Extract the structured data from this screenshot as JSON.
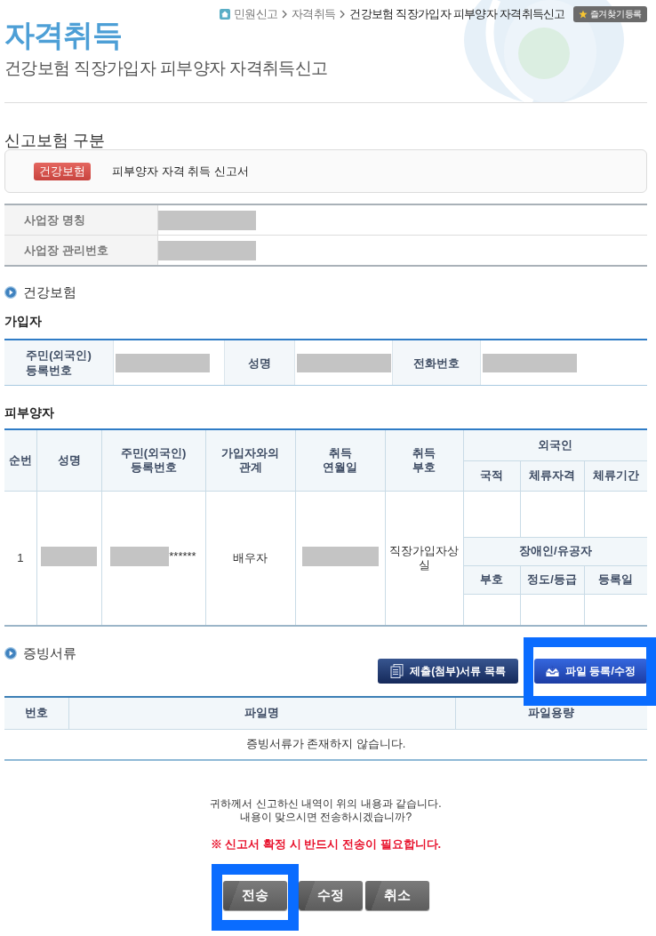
{
  "breadcrumb": [
    {
      "label": "민원신고",
      "current": false
    },
    {
      "label": "자격취득",
      "current": false
    },
    {
      "label": "건강보험 직장가입자 피부양자 자격취득신고",
      "current": true
    }
  ],
  "bookmark_button": {
    "label": "즐겨찾기등록"
  },
  "title": "자격취득",
  "subtitle": "건강보험 직장가입자 피부양자 자격취득신고",
  "insurance_type": {
    "heading": "신고보험 구분",
    "badge": "건강보험",
    "form_name": "피부양자 자격 취득 신고서"
  },
  "workplace": [
    {
      "label": "사업장 명칭",
      "redacted": true
    },
    {
      "label": "사업장 관리번호",
      "redacted": true
    }
  ],
  "health_section": {
    "title": "건강보험"
  },
  "subscriber": {
    "heading": "가입자",
    "fields": [
      {
        "label": "주민(외국인)\n등록번호",
        "redacted": true
      },
      {
        "label": "성명",
        "redacted": true
      },
      {
        "label": "전화번호",
        "redacted": true
      }
    ]
  },
  "dependents": {
    "heading": "피부양자",
    "columns": [
      "순번",
      "성명",
      "주민(외국인)\n등록번호",
      "가입자와의\n관계",
      "취득\n연월일",
      "취득\n부호"
    ],
    "foreigner": {
      "label": "외국인",
      "columns": [
        "국적",
        "체류자격",
        "체류기간"
      ]
    },
    "disability": {
      "label": "장애인/유공자",
      "columns": [
        "부호",
        "정도/등급",
        "등록일"
      ]
    },
    "rows": [
      {
        "cells": [
          {
            "text": "1",
            "redacted": false
          },
          {
            "redacted": true
          },
          {
            "text": "******",
            "redacted": true
          },
          {
            "text": "배우자",
            "redacted": false
          },
          {
            "redacted": true
          },
          {
            "text": "직장가입자상실",
            "redacted": false
          }
        ]
      }
    ]
  },
  "evidence": {
    "title": "증빙서류",
    "buttons": [
      {
        "label": "제출(첨부)서류 목록",
        "kind": "list",
        "highlighted": false
      },
      {
        "label": "파일 등록/수정",
        "kind": "upload",
        "highlighted": true
      }
    ],
    "columns": [
      "번호",
      "파일명",
      "파일용량"
    ],
    "empty_message": "증빙서류가 존재하지 않습니다."
  },
  "confirm": {
    "message": [
      "귀하께서 신고하신 내역이 위의 내용과 같습니다.",
      "내용이 맞으시면 전송하시겠습니까?"
    ],
    "warning": "※ 신고서 확정 시 반드시 전송이 필요합니다.",
    "buttons": [
      {
        "label": "전송",
        "highlighted": true
      },
      {
        "label": "수정",
        "highlighted": false
      },
      {
        "label": "취소",
        "highlighted": false
      }
    ]
  }
}
